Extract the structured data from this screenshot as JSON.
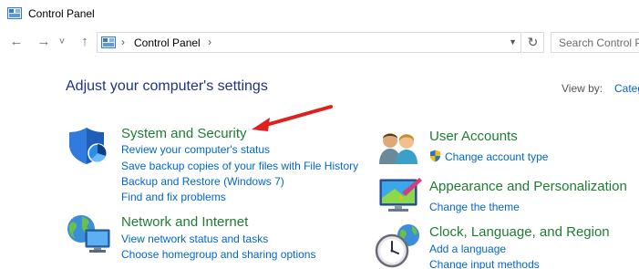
{
  "window": {
    "title": "Control Panel"
  },
  "nav": {
    "back": "←",
    "forward": "→",
    "recent": "˅",
    "up": "↑",
    "breadcrumb": "Control Panel",
    "refresh": "↻",
    "search_placeholder": "Search Control P"
  },
  "main": {
    "heading": "Adjust your computer's settings",
    "view_by_label": "View by:",
    "view_by_value": "Categ"
  },
  "categories": {
    "system_security": {
      "title": "System and Security",
      "links": [
        "Review your computer's status",
        "Save backup copies of your files with File History",
        "Backup and Restore (Windows 7)",
        "Find and fix problems"
      ]
    },
    "network": {
      "title": "Network and Internet",
      "links": [
        "View network status and tasks",
        "Choose homegroup and sharing options"
      ]
    },
    "user_accounts": {
      "title": "User Accounts",
      "links": [
        "Change account type"
      ]
    },
    "appearance": {
      "title": "Appearance and Personalization",
      "links": [
        "Change the theme"
      ]
    },
    "clock": {
      "title": "Clock, Language, and Region",
      "links": [
        "Add a language",
        "Change input methods"
      ]
    }
  },
  "colors": {
    "heading": "#1e3287",
    "category": "#1e7d32",
    "link": "#0066cc",
    "arrow": "#e0201e"
  }
}
